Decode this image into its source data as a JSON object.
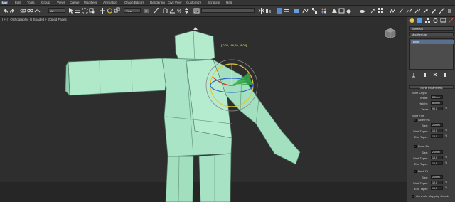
{
  "menubar": {
    "logo": "Max",
    "items": [
      "Edit",
      "Tools",
      "Group",
      "Views",
      "Create",
      "Modifiers",
      "Animation",
      "Graph Editors",
      "Rendering",
      "Civil View",
      "Customize",
      "Scripting",
      "Help"
    ]
  },
  "toolbar": {
    "filter_select": "All",
    "view_select": "View",
    "selection_set_select": ""
  },
  "viewport": {
    "label": "[ + ] [ Orthographic ] [ Shaded + Edged Faces ]",
    "transform_readout": "[ 0,00, -96,29, -8,00]"
  },
  "command_panel": {
    "object_name": "Bone006",
    "modifier_list": "Modifier List",
    "stack_items": [
      "Bone"
    ],
    "rollout_title": "Bone Parameters",
    "bone_object_group": "Bone Object",
    "width_label": "Width:",
    "width_value": "8,0mm",
    "height_label": "Height:",
    "height_value": "8,0mm",
    "taper_label": "Taper:",
    "taper_value": "90,0",
    "bone_fins_group": "Bone Fins",
    "side_fins_label": "Side Fins",
    "front_fin_label": "Front Fin",
    "back_fin_label": "Back Fin",
    "size_label": "Size:",
    "size_value": "2,0mm",
    "start_taper_label": "Start Taper:",
    "start_taper_value": "10,0",
    "end_taper_label": "End Taper:",
    "end_taper_value": "10,0",
    "percent": "%",
    "gen_mapping_label": "Generate Mapping Coords"
  },
  "colors": {
    "mesh_fill": "#a6e3c3",
    "mesh_edge": "#4d7a64",
    "gizmo_x": "#cc3333",
    "gizmo_y": "#33aa33",
    "gizmo_z": "#3366cc",
    "gizmo_ring": "#e0c83a"
  }
}
